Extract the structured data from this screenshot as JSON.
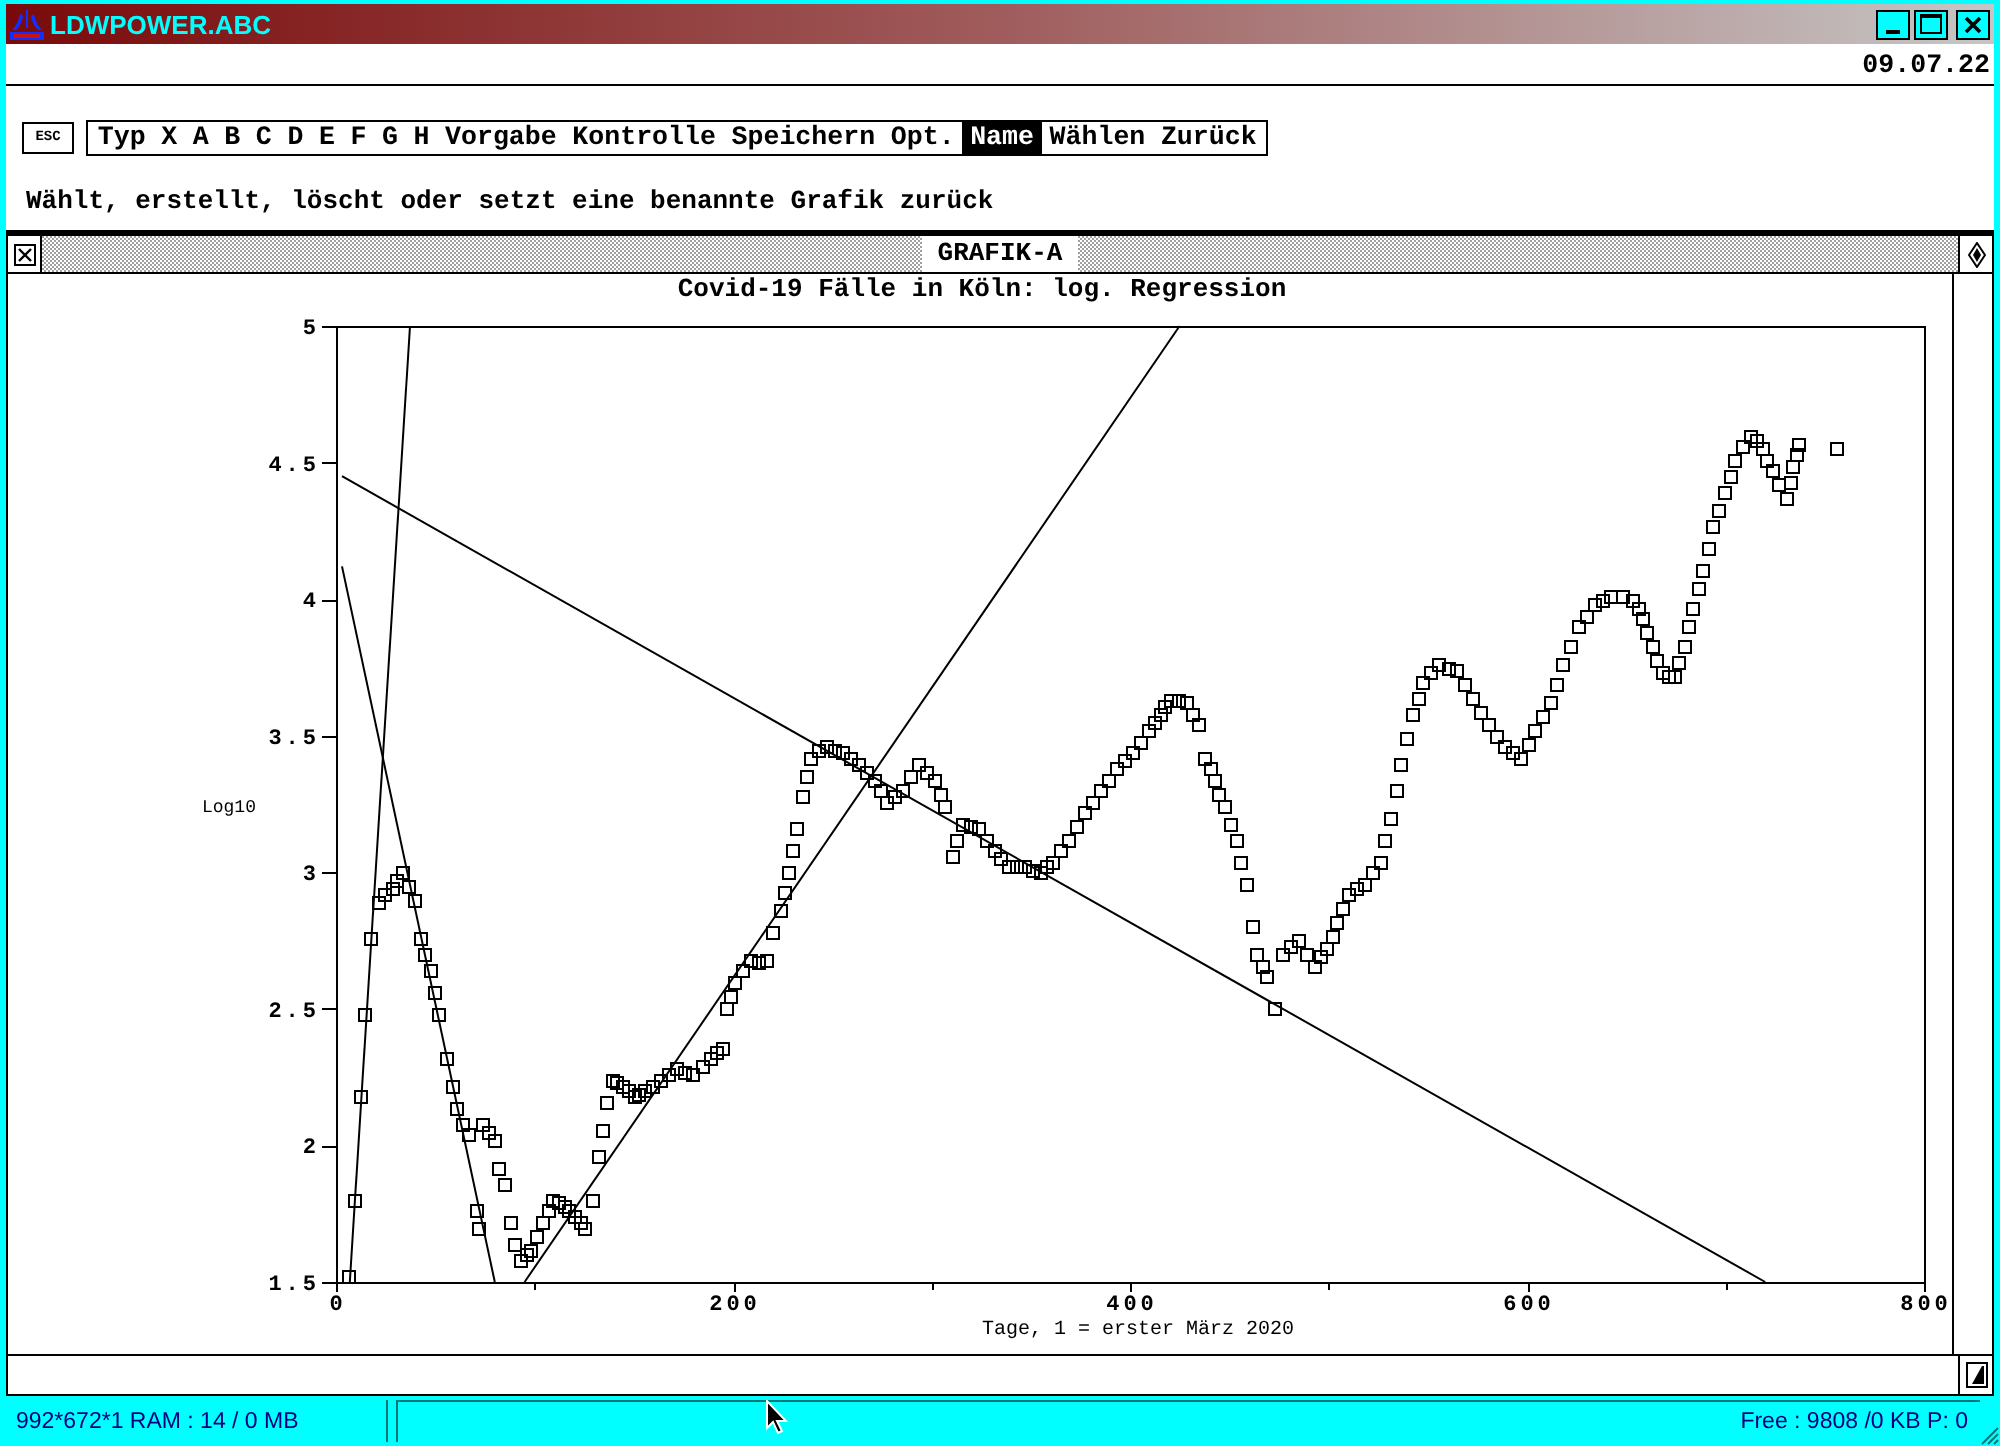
{
  "window": {
    "title": "LDWPOWER.ABC"
  },
  "date": "09.07.22",
  "esc_key": "ESC",
  "menu": [
    {
      "label": "Typ",
      "selected": false
    },
    {
      "label": "X",
      "selected": false
    },
    {
      "label": "A",
      "selected": false
    },
    {
      "label": "B",
      "selected": false
    },
    {
      "label": "C",
      "selected": false
    },
    {
      "label": "D",
      "selected": false
    },
    {
      "label": "E",
      "selected": false
    },
    {
      "label": "F",
      "selected": false
    },
    {
      "label": "G",
      "selected": false
    },
    {
      "label": "H",
      "selected": false
    },
    {
      "label": "Vorgabe",
      "selected": false
    },
    {
      "label": "Kontrolle",
      "selected": false
    },
    {
      "label": "Speichern",
      "selected": false
    },
    {
      "label": "Opt.",
      "selected": false
    },
    {
      "label": "Name",
      "selected": true
    },
    {
      "label": "Wählen",
      "selected": false
    },
    {
      "label": "Zurück",
      "selected": false
    }
  ],
  "hint": "Wählt, erstellt, löscht oder setzt eine benannte Grafik zurück",
  "graphic_window": {
    "title": "GRAFIK-A",
    "chart_data": {
      "type": "scatter",
      "title": "Covid-19 Fälle in Köln: log. Regression",
      "xlabel": "Tage, 1 = erster März 2020",
      "ylabel": "Log10",
      "xlim": [
        0,
        800
      ],
      "ylim": [
        1.5,
        5
      ],
      "xticks": [
        0,
        200,
        400,
        600,
        800
      ],
      "yticks": [
        1.5,
        2,
        2.5,
        3,
        3.5,
        4,
        4.5,
        5
      ],
      "series": [
        {
          "type": "scatter",
          "x": [
            6.5,
            9,
            12,
            14.5,
            17,
            21,
            24.5,
            28,
            30.7,
            33.5,
            36,
            39,
            42.5,
            44.7,
            47,
            49,
            51.5,
            55,
            58,
            60.5,
            63,
            66,
            71,
            72,
            74,
            77,
            79.5,
            82,
            85,
            87.5,
            90,
            93,
            95.5,
            98,
            101,
            104,
            106.5,
            109,
            112,
            114.5,
            117,
            120,
            122.5,
            125,
            129,
            132,
            134,
            136,
            139,
            141.5,
            144,
            147,
            150,
            152.5,
            155,
            159,
            163,
            167,
            171,
            175,
            179.5,
            184,
            188,
            191,
            194,
            196,
            198.5,
            201,
            205,
            209,
            213,
            217,
            220,
            224,
            226,
            228,
            230,
            232,
            235,
            237,
            239,
            243,
            247,
            251,
            255,
            259,
            263,
            267,
            271,
            274,
            277,
            281,
            285,
            289,
            293,
            297,
            301,
            304,
            306.5,
            310,
            312.5,
            315,
            319,
            323,
            327,
            331,
            335,
            339,
            343,
            347,
            351,
            355,
            358,
            360.5,
            365,
            369,
            373,
            377,
            381,
            385,
            389,
            393,
            397,
            401,
            405,
            409,
            412,
            415,
            417.5,
            420,
            424,
            428,
            431,
            434,
            437.5,
            440,
            442,
            444.5,
            447,
            450,
            453,
            455.5,
            458,
            461,
            463.5,
            466,
            469,
            472.5,
            477,
            481,
            485,
            489,
            493,
            496,
            499,
            501.5,
            504,
            507,
            509.5,
            513.5,
            517.5,
            521.5,
            525.5,
            528,
            531,
            534,
            536.5,
            539,
            542,
            545,
            547.5,
            551.5,
            555.5,
            560,
            564,
            568,
            572,
            576,
            580,
            584,
            588,
            592,
            596,
            600,
            604,
            608,
            612,
            615,
            617.5,
            621.5,
            625.5,
            630,
            634,
            638,
            642,
            647.5,
            653,
            655.5,
            658,
            660,
            662.5,
            665,
            668,
            671,
            674,
            676.5,
            679,
            681,
            683.5,
            686,
            688,
            691,
            693.5,
            696,
            699,
            702,
            704.5,
            708,
            712,
            715,
            718,
            720.5,
            723,
            726.5,
            730,
            732,
            734,
            735.5,
            737,
            755.5
          ],
          "values": [
            1.52,
            1.8,
            2.18,
            2.48,
            2.76,
            2.89,
            2.92,
            2.94,
            2.97,
            3.0,
            2.95,
            2.9,
            2.76,
            2.7,
            2.64,
            2.56,
            2.48,
            2.32,
            2.22,
            2.14,
            2.08,
            2.04,
            1.76,
            1.7,
            2.08,
            2.05,
            2.02,
            1.92,
            1.86,
            1.72,
            1.64,
            1.58,
            1.6,
            1.62,
            1.67,
            1.72,
            1.76,
            1.8,
            1.79,
            1.78,
            1.76,
            1.74,
            1.72,
            1.7,
            1.8,
            1.96,
            2.06,
            2.16,
            2.24,
            2.23,
            2.22,
            2.2,
            2.18,
            2.19,
            2.2,
            2.22,
            2.24,
            2.26,
            2.28,
            2.27,
            2.26,
            2.29,
            2.32,
            2.34,
            2.36,
            2.5,
            2.55,
            2.6,
            2.64,
            2.68,
            2.67,
            2.68,
            2.78,
            2.86,
            2.93,
            3.0,
            3.08,
            3.16,
            3.28,
            3.35,
            3.42,
            3.45,
            3.46,
            3.45,
            3.44,
            3.42,
            3.4,
            3.37,
            3.34,
            3.3,
            3.26,
            3.28,
            3.3,
            3.35,
            3.4,
            3.37,
            3.34,
            3.29,
            3.24,
            3.06,
            3.12,
            3.18,
            3.17,
            3.16,
            3.12,
            3.08,
            3.05,
            3.02,
            3.02,
            3.02,
            3.01,
            3.0,
            3.02,
            3.04,
            3.08,
            3.12,
            3.17,
            3.22,
            3.26,
            3.3,
            3.34,
            3.38,
            3.41,
            3.44,
            3.48,
            3.52,
            3.55,
            3.58,
            3.61,
            3.63,
            3.63,
            3.62,
            3.58,
            3.54,
            3.42,
            3.38,
            3.34,
            3.29,
            3.24,
            3.18,
            3.12,
            3.04,
            2.96,
            2.8,
            2.7,
            2.66,
            2.62,
            2.5,
            2.7,
            2.73,
            2.75,
            2.7,
            2.66,
            2.69,
            2.72,
            2.77,
            2.82,
            2.87,
            2.92,
            2.94,
            2.96,
            3.0,
            3.04,
            3.12,
            3.2,
            3.3,
            3.4,
            3.49,
            3.58,
            3.64,
            3.7,
            3.73,
            3.76,
            3.75,
            3.74,
            3.69,
            3.64,
            3.59,
            3.54,
            3.5,
            3.46,
            3.44,
            3.42,
            3.47,
            3.52,
            3.57,
            3.62,
            3.69,
            3.76,
            3.83,
            3.9,
            3.94,
            3.98,
            4.0,
            4.01,
            4.01,
            4.0,
            3.97,
            3.93,
            3.88,
            3.83,
            3.78,
            3.73,
            3.72,
            3.72,
            3.77,
            3.83,
            3.9,
            3.97,
            4.04,
            4.11,
            4.19,
            4.27,
            4.33,
            4.39,
            4.45,
            4.51,
            4.56,
            4.6,
            4.58,
            4.55,
            4.51,
            4.47,
            4.42,
            4.37,
            4.43,
            4.49,
            4.53,
            4.57,
            4.55
          ]
        },
        {
          "type": "line",
          "x": [
            7,
            37.3
          ],
          "values": [
            1.5,
            5
          ]
        },
        {
          "type": "line",
          "x": [
            3,
            80
          ],
          "values": [
            4.12,
            1.5
          ]
        },
        {
          "type": "line",
          "x": [
            3,
            720
          ],
          "values": [
            4.45,
            1.5
          ]
        },
        {
          "type": "line",
          "x": [
            95,
            425
          ],
          "values": [
            1.5,
            5
          ]
        }
      ]
    }
  },
  "status_bar": {
    "left": "992*672*1 RAM : 14 / 0 MB",
    "right": "Free : 9808 /0 KB P: 0"
  }
}
